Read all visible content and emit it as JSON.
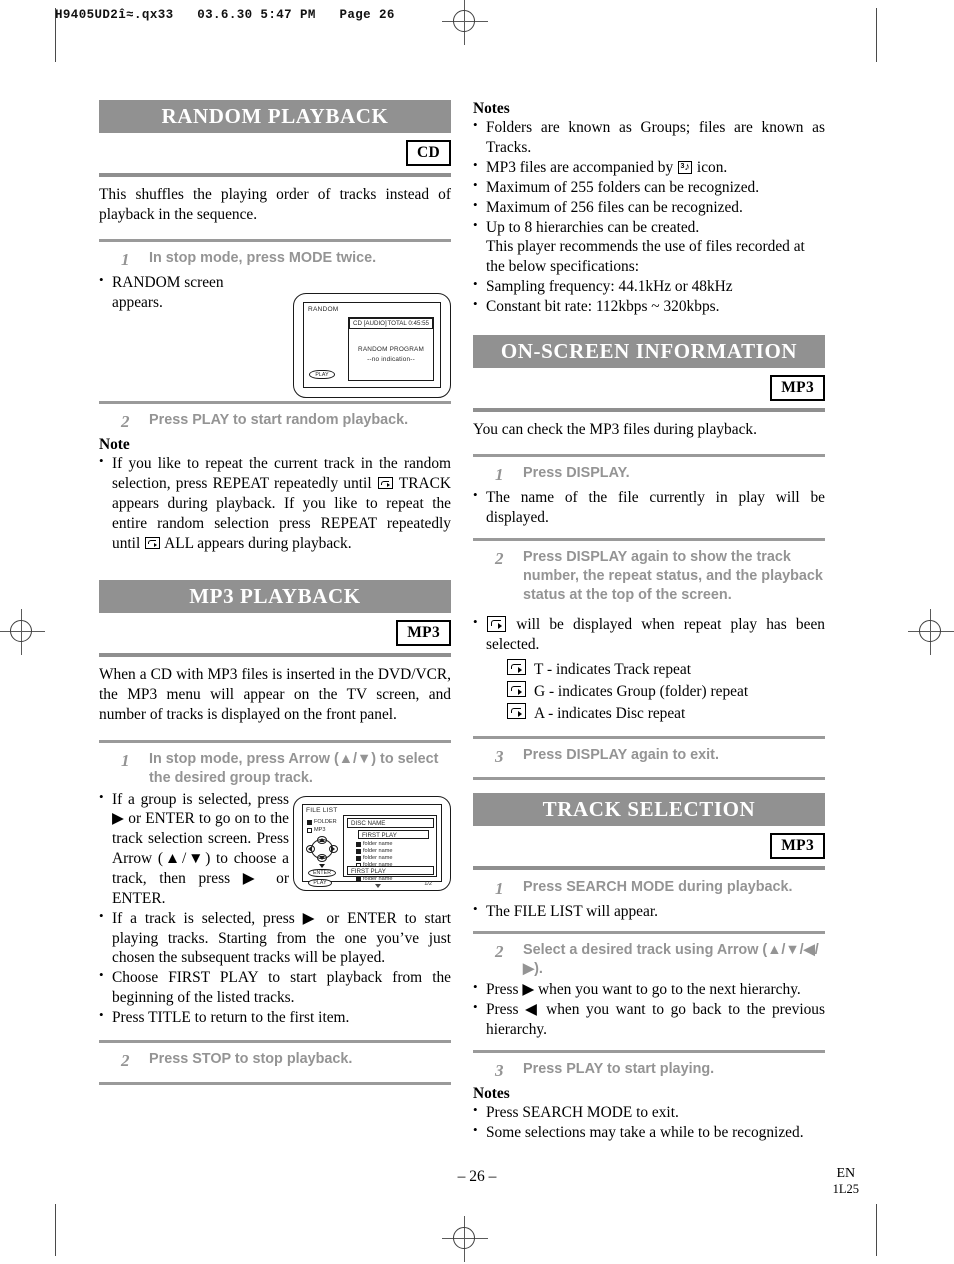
{
  "file_header": "H9405UD2î≈.qx33   03.6.30 5:47 PM   Page 26",
  "footer": {
    "page_number": "– 26 –",
    "lang": "EN",
    "code": "1L25"
  },
  "sections": {
    "random_playback": {
      "title": "RANDOM PLAYBACK",
      "badge": "CD",
      "intro": "This shuffles the playing order of tracks instead of playback in the sequence.",
      "step1": {
        "num": "1",
        "text": "In stop mode, press MODE twice."
      },
      "step1_bullet": "RANDOM screen appears.",
      "step2": {
        "num": "2",
        "text": "Press PLAY to start random playback."
      },
      "note_head": "Note",
      "note_part1": "If you like to repeat the current track in the random selection, press REPEAT repeatedly until",
      "note_part2": "TRACK appears during playback. If you like to repeat the entire random selection press REPEAT repeatedly until",
      "note_part3": "ALL appears during playback."
    },
    "random_screen": {
      "title": "RANDOM",
      "status_left": "CD [AUDIO]",
      "status_right": "TOTAL 0:45:55",
      "line1": "RANDOM PROGRAM",
      "line2": "--no indication--",
      "play_button": "PLAY"
    },
    "mp3_playback": {
      "title": "MP3 PLAYBACK",
      "badge": "MP3",
      "intro": "When a CD with MP3 files is inserted in the DVD/VCR, the MP3 menu will appear on the TV screen, and number of tracks is displayed on the front panel.",
      "step1": {
        "num": "1",
        "text": "In stop mode, press Arrow (▲/▼) to select the desired group track."
      },
      "bullets": [
        "If a group is selected, press ▶ or ENTER to go on to the track selection screen. Press Arrow (▲/▼) to choose a track, then press ▶ or ENTER.",
        "If a track is selected, press ▶ or ENTER to start playing tracks. Starting from the one you’ve just chosen the subsequent tracks will be played.",
        "Choose FIRST PLAY to start playback from the beginning of the listed tracks.",
        "Press TITLE to return to the first item."
      ],
      "step2": {
        "num": "2",
        "text": "Press STOP to stop playback."
      }
    },
    "file_list_screen": {
      "title": "FILE LIST",
      "legend_folder": "FOLDER",
      "legend_mp3": "MP3",
      "disc_name": "DISC NAME",
      "first_play_top": "FIRST PLAY",
      "rows": [
        "folder name",
        "folder name",
        "folder name",
        "folder name",
        "folder name",
        "folder name"
      ],
      "page_indicator": "1/2",
      "enter_button": "ENTER",
      "play_button": "PLAY",
      "first_play_bottom": "FIRST PLAY"
    },
    "mp3_notes": {
      "head": "Notes",
      "items": [
        "Folders are known as Groups; files are known as Tracks.",
        "Maximum of 255 folders can be recognized.",
        "Maximum of 256 files can be recognized.",
        "Sampling frequency: 44.1kHz or 48kHz",
        "Constant bit rate: 112kbps ~ 320kbps."
      ],
      "mp3_icon_before": "MP3 files are accompanied by",
      "mp3_icon_after": "icon.",
      "hierarchy_item": "Up to 8 hierarchies can be created.",
      "hierarchy_cont": "This player recommends the use of files recorded at the below specifications:"
    },
    "on_screen_information": {
      "title": "ON-SCREEN INFORMATION",
      "badge": "MP3",
      "intro": "You can check the MP3 files during playback.",
      "step1": {
        "num": "1",
        "text": "Press DISPLAY."
      },
      "step1_bullet": "The name of the file currently in play will be displayed.",
      "step2": {
        "num": "2",
        "text": "Press DISPLAY again to show the track number, the repeat status, and the playback status at the top of the screen."
      },
      "step2_bullet": "will be displayed when repeat play has been selected.",
      "repeat_modes": [
        "T - indicates Track repeat",
        "G - indicates Group (folder) repeat",
        "A - indicates Disc repeat"
      ],
      "step3": {
        "num": "3",
        "text": "Press DISPLAY again to exit."
      }
    },
    "track_selection": {
      "title": "TRACK SELECTION",
      "badge": "MP3",
      "step1": {
        "num": "1",
        "text": "Press SEARCH MODE during playback."
      },
      "step1_bullet": "The FILE LIST will appear.",
      "step2": {
        "num": "2",
        "text": "Select a desired track using Arrow (▲/▼/◀/▶)."
      },
      "step2_bullets": [
        "Press ▶ when you want to go to the next hierarchy.",
        "Press ◀ when you want to go back to the previous hierarchy."
      ],
      "step3": {
        "num": "3",
        "text": "Press PLAY to start playing."
      },
      "notes_head": "Notes",
      "notes": [
        "Press SEARCH MODE to exit.",
        "Some selections may take a while to be recognized."
      ]
    }
  },
  "colors": {
    "banner_gray": "#919191",
    "rule_gray": "#8f8f8f",
    "step_gray": "#949494"
  }
}
